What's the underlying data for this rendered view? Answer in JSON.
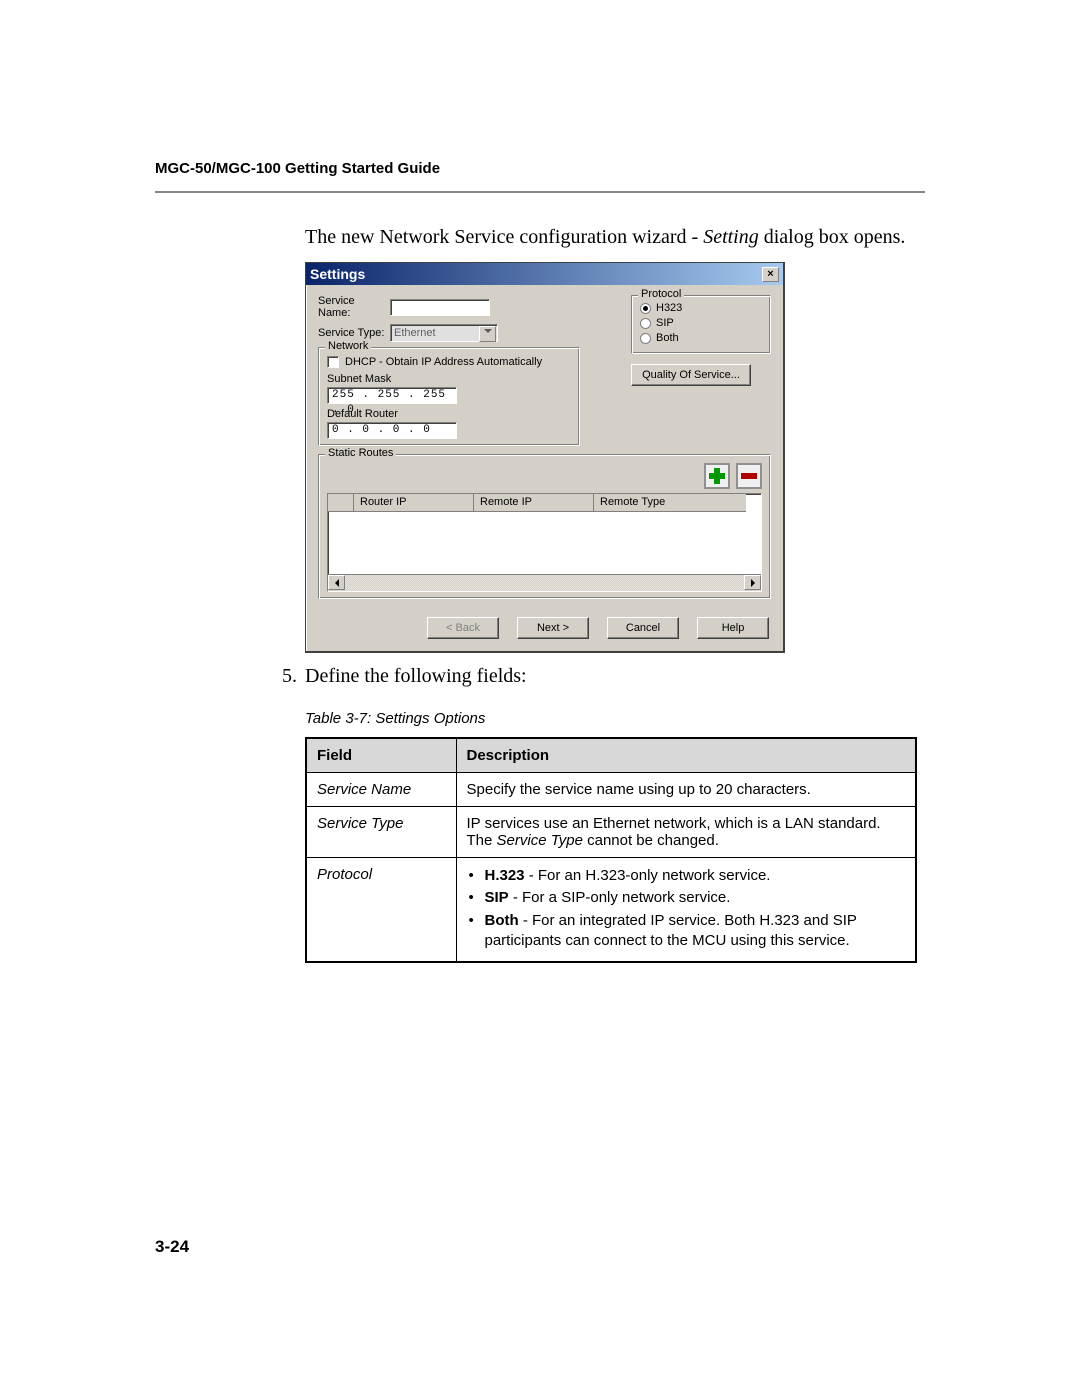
{
  "header": "MGC-50/MGC-100 Getting Started Guide",
  "intro_prefix": "The new Network Service configuration wizard - ",
  "intro_italic": "Setting",
  "intro_suffix": " dialog box opens.",
  "step_number": "5.",
  "step_text": "Define the following fields:",
  "table_caption": "Table 3-7: Settings Options",
  "table_headers": {
    "field": "Field",
    "description": "Description"
  },
  "rows": {
    "r1_field": "Service Name",
    "r1_desc": "Specify the service name using up to 20 characters.",
    "r2_field": "Service Type",
    "r2_desc_a": "IP services use an Ethernet network, which is a LAN standard. The ",
    "r2_desc_i": "Service Type",
    "r2_desc_b": " cannot be changed.",
    "r3_field": "Protocol",
    "r3_b1_bold": "H.323",
    "r3_b1_rest": " - For an H.323-only network service.",
    "r3_b2_bold": "SIP",
    "r3_b2_rest": " - For a SIP-only network service.",
    "r3_b3_bold": "Both",
    "r3_b3_rest": " - For an integrated IP service. Both H.323 and SIP participants can connect to the MCU using this service."
  },
  "page_number": "3-24",
  "dialog": {
    "title": "Settings",
    "close_label": "×",
    "service_name_label": "Service Name:",
    "service_name_value": "",
    "service_type_label": "Service Type:",
    "service_type_value": "Ethernet",
    "network_legend": "Network",
    "dhcp_label": "DHCP - Obtain IP Address Automatically",
    "subnet_label": "Subnet Mask",
    "subnet_value": "255 . 255 . 255 .  0",
    "router_label": "Default Router",
    "router_value": " 0  .  0  .  0  .  0",
    "protocol_legend": "Protocol",
    "protocol_options": {
      "h323": "H323",
      "sip": "SIP",
      "both": "Both"
    },
    "protocol_selected": "h323",
    "qos_button": "Quality Of Service...",
    "static_legend": "Static Routes",
    "add_icon_name": "plus-icon",
    "remove_icon_name": "minus-icon",
    "grid_headers": {
      "c1": "",
      "c2": "Router IP",
      "c3": "Remote IP",
      "c4": "Remote Type"
    },
    "buttons": {
      "back": "< Back",
      "next": "Next >",
      "cancel": "Cancel",
      "help": "Help"
    }
  }
}
